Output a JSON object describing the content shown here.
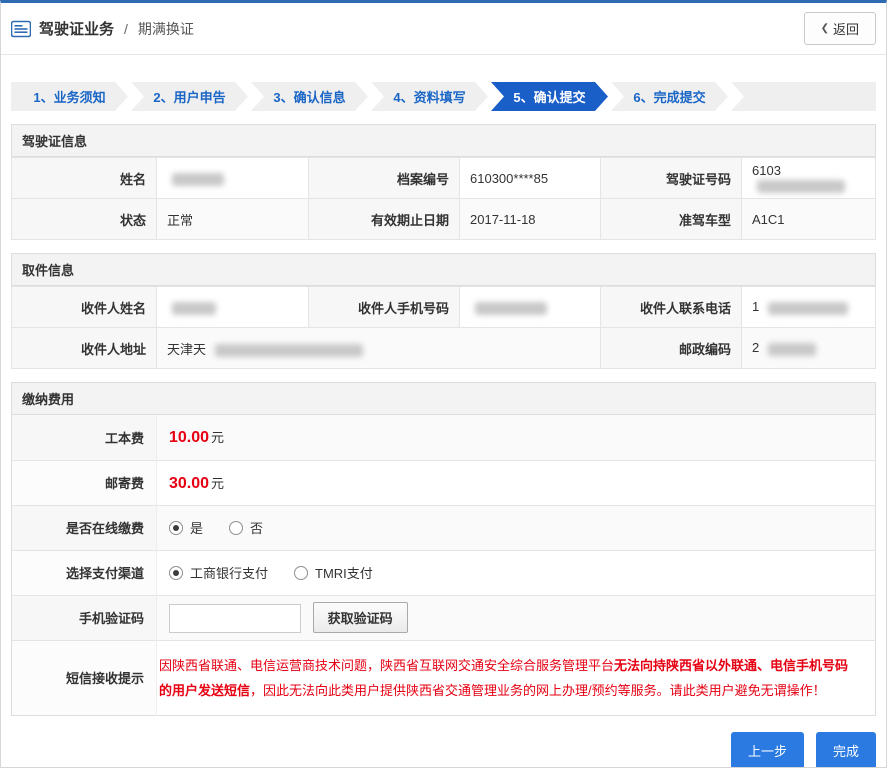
{
  "header": {
    "title_primary": "驾驶证业务",
    "title_separator": "/",
    "title_secondary": "期满换证",
    "back_chevron": "❮",
    "back_label": "返回"
  },
  "steps": [
    {
      "label": "1、业务须知"
    },
    {
      "label": "2、用户申告"
    },
    {
      "label": "3、确认信息"
    },
    {
      "label": "4、资料填写"
    },
    {
      "label": "5、确认提交"
    },
    {
      "label": "6、完成提交"
    }
  ],
  "active_step": "5、确认提交",
  "license_info": {
    "title": "驾驶证信息",
    "name_label": "姓名",
    "name_value": "",
    "file_no_label": "档案编号",
    "file_no_value": "610300****85",
    "license_no_label": "驾驶证号码",
    "license_no_value": "6103",
    "status_label": "状态",
    "status_value": "正常",
    "expiry_label": "有效期止日期",
    "expiry_value": "2017-11-18",
    "vehicle_label": "准驾车型",
    "vehicle_value": "A1C1"
  },
  "pickup_info": {
    "title": "取件信息",
    "recipient_name_label": "收件人姓名",
    "recipient_name_value": "",
    "mobile_label": "收件人手机号码",
    "mobile_value": "",
    "phone_label": "收件人联系电话",
    "phone_value": "1",
    "address_label": "收件人地址",
    "address_value": "天津天",
    "postcode_label": "邮政编码",
    "postcode_value": "2"
  },
  "fees": {
    "title": "缴纳费用",
    "production_fee_label": "工本费",
    "production_fee_value": "10.00",
    "mailing_fee_label": "邮寄费",
    "mailing_fee_value": "30.00",
    "fee_unit": "元",
    "online_payment_label": "是否在线缴费",
    "online_yes": "是",
    "online_no": "否",
    "online_selected": "是",
    "channel_label": "选择支付渠道",
    "channel_icbc": "工商银行支付",
    "channel_tmri": "TMRI支付",
    "channel_selected": "工商银行支付",
    "sms_code_label": "手机验证码",
    "sms_code_value": "",
    "get_code_button": "获取验证码",
    "notice_label": "短信接收提示",
    "notice_part1": "因陕西省联通、电信运营商技术问题，陕西省互联网交通安全综合服务管理平台",
    "notice_bold": "无法向持陕西省以外联通、电信手机号码的用户发送短信",
    "notice_part2": "，因此无法向此类用户提供陕西省交通管理业务的网上办理/预约等服务。请此类用户避免无谓操作！"
  },
  "footer": {
    "prev_button": "上一步",
    "finish_button": "完成"
  },
  "colors": {
    "top_bar": "#2f6bb3",
    "step_active": "#1a5fc8",
    "step_text": "#1a66c6",
    "fee_red": "#e60012",
    "button_blue": "#2a7ae2"
  }
}
